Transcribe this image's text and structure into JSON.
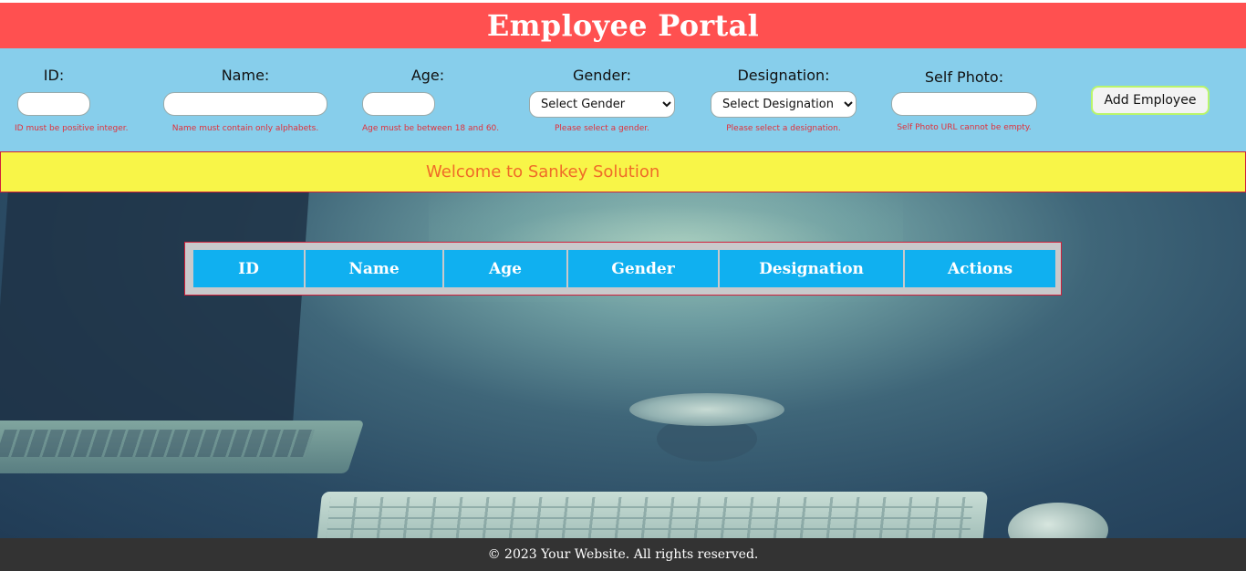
{
  "header": {
    "title": "Employee Portal"
  },
  "form": {
    "id": {
      "label": "ID:",
      "value": "",
      "error": "ID must be positive integer."
    },
    "name": {
      "label": "Name:",
      "value": "",
      "error": "Name must contain only alphabets."
    },
    "age": {
      "label": "Age:",
      "value": "",
      "error": "Age must be between 18 and 60."
    },
    "gender": {
      "label": "Gender:",
      "selected": "Select Gender",
      "error": "Please select a gender."
    },
    "designation": {
      "label": "Designation:",
      "selected": "Select Designation",
      "error": "Please select a designation."
    },
    "photo": {
      "label": "Self Photo:",
      "value": "",
      "error": "Self Photo URL cannot be empty."
    },
    "add_button": "Add Employee"
  },
  "banner": {
    "text": "Welcome to Sankey Solution"
  },
  "table": {
    "columns": [
      "ID",
      "Name",
      "Age",
      "Gender",
      "Designation",
      "Actions"
    ],
    "rows": []
  },
  "footer": {
    "text": "© 2023 Your Website. All rights reserved."
  },
  "colors": {
    "header_bg": "#ff5050",
    "form_bg": "#87ceeb",
    "banner_bg": "#f8f548",
    "banner_text": "#ef6b28",
    "error_text": "#e0303a",
    "table_header_bg": "#10b0f0",
    "footer_bg": "#333333"
  }
}
